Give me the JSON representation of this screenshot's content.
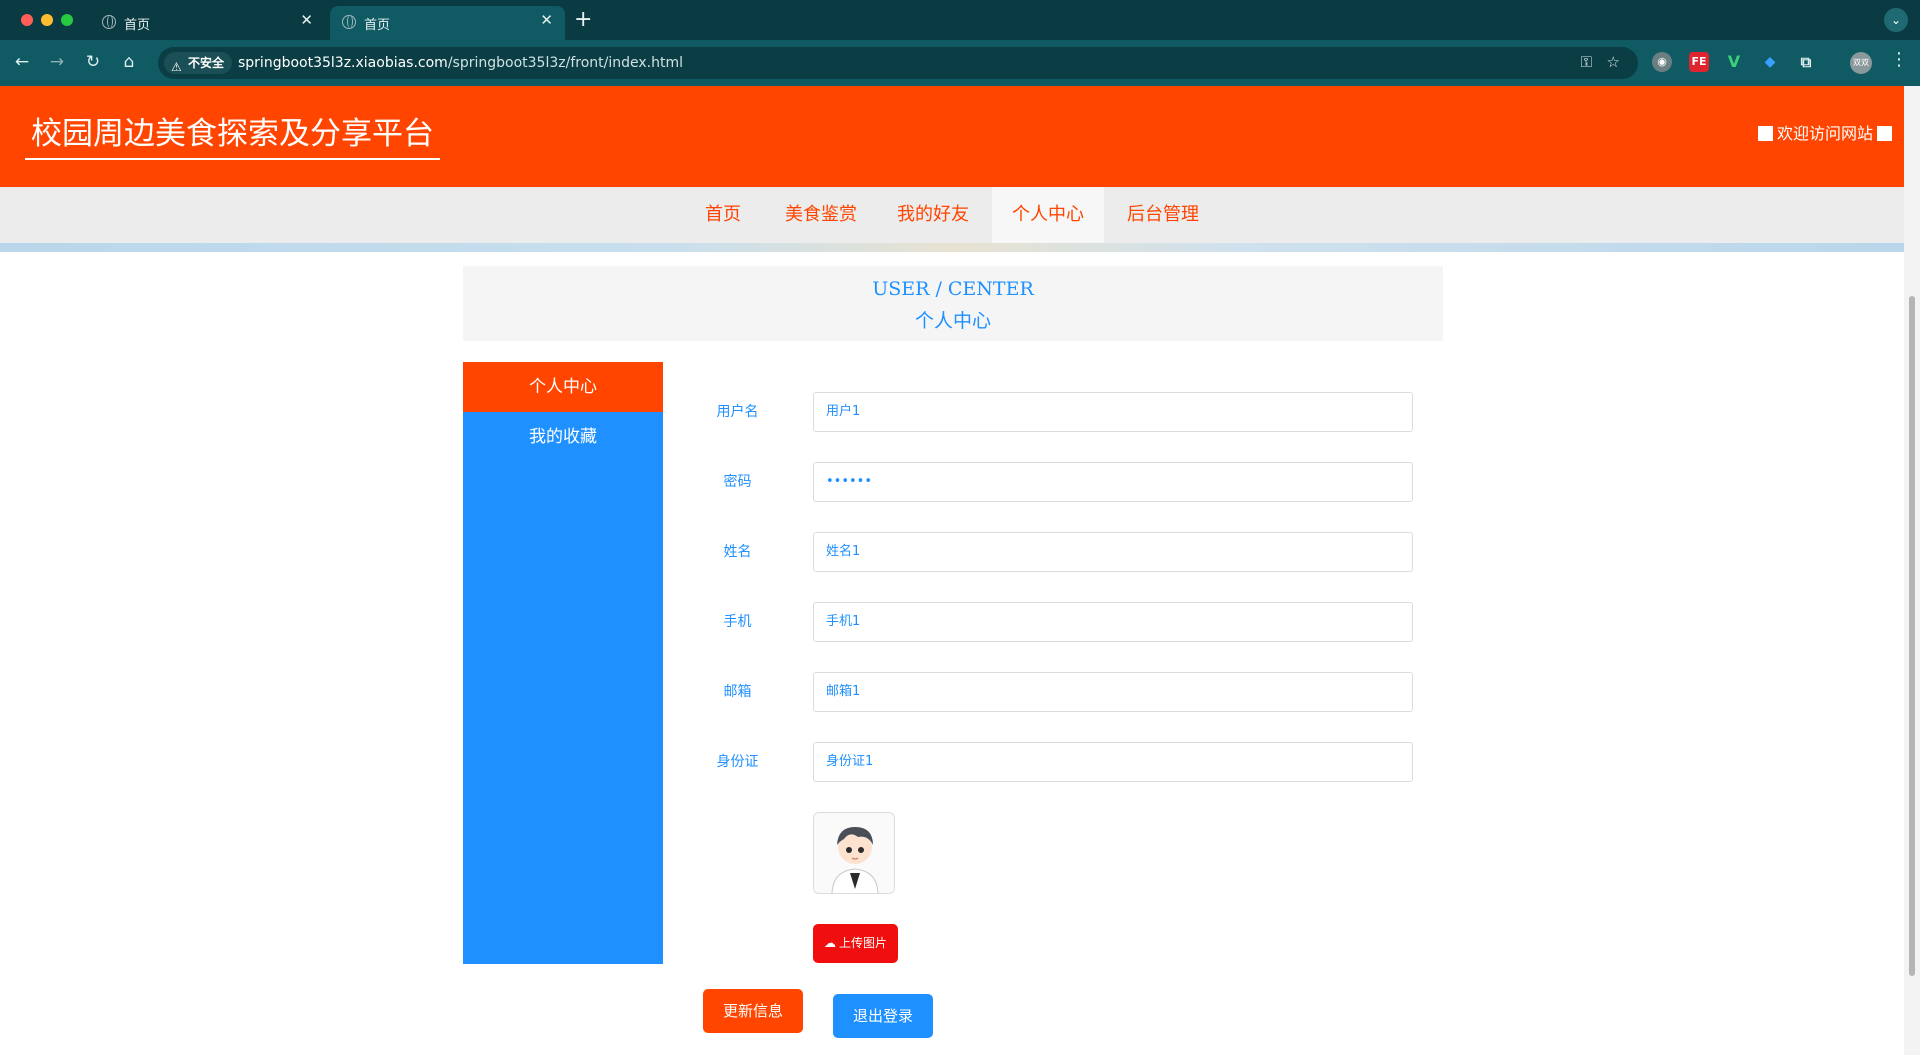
{
  "browser": {
    "tabs": [
      {
        "title": "首页",
        "active": false
      },
      {
        "title": "首页",
        "active": true
      }
    ],
    "security_label": "不安全",
    "url_host": "springboot35l3z.xiaobias.com",
    "url_path": "/springboot35l3z/front/index.html",
    "profile_label": "双双"
  },
  "site": {
    "title": "校园周边美食探索及分享平台",
    "welcome": "欢迎访问网站",
    "brand_color": "#ff4500",
    "accent_color": "#1e90ff"
  },
  "nav": {
    "items": [
      "首页",
      "美食鉴赏",
      "我的好友",
      "个人中心",
      "后台管理"
    ],
    "active_index": 3
  },
  "user_center": {
    "title_en": "USER / CENTER",
    "title_cn": "个人中心"
  },
  "side_menu": {
    "items": [
      "个人中心",
      "我的收藏"
    ],
    "active_index": 0
  },
  "form": {
    "fields": [
      {
        "label": "用户名",
        "value": "用户1"
      },
      {
        "label": "密码",
        "value": "••••••"
      },
      {
        "label": "姓名",
        "value": "姓名1"
      },
      {
        "label": "手机",
        "value": "手机1"
      },
      {
        "label": "邮箱",
        "value": "邮箱1"
      },
      {
        "label": "身份证",
        "value": "身份证1"
      }
    ],
    "upload_label": "上传图片",
    "update_label": "更新信息",
    "logout_label": "退出登录"
  },
  "icons": {
    "back": "back-arrow-icon",
    "forward": "forward-arrow-icon",
    "reload": "reload-icon",
    "home": "home-icon",
    "warning": "warning-icon",
    "key": "key-icon",
    "star": "star-icon",
    "upload": "cloud-upload-icon"
  }
}
